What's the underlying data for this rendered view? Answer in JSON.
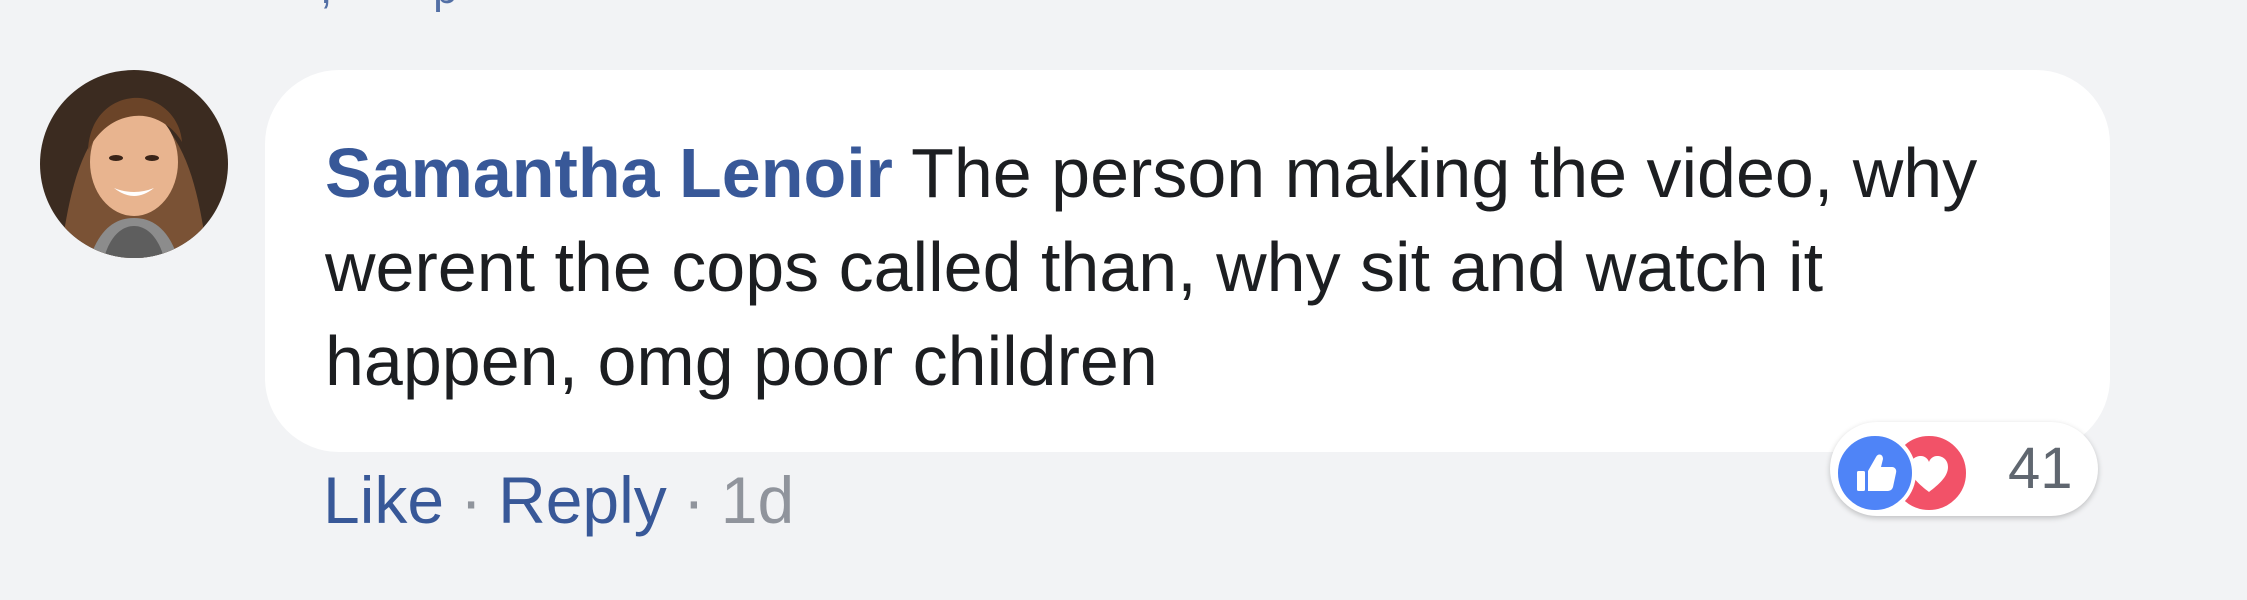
{
  "previous_comment": {
    "cutoff_text": ", · · · p · · · · ·"
  },
  "comment": {
    "author": "Samantha Lenoir",
    "text": "The person making the video, why werent the cops called than, why sit and watch it happen, omg poor children",
    "actions": {
      "like_label": "Like",
      "separator": "·",
      "reply_label": "Reply",
      "timestamp": "1d"
    },
    "reactions": {
      "types": [
        "like",
        "love"
      ],
      "count": "41",
      "colors": {
        "like": "#4f84f7",
        "love": "#f25268"
      }
    }
  },
  "icons": {
    "like": "thumbs-up-icon",
    "love": "heart-icon"
  },
  "colors": {
    "link": "#385898",
    "text": "#1c1e21",
    "meta": "#90949c",
    "background": "#f2f3f5"
  }
}
